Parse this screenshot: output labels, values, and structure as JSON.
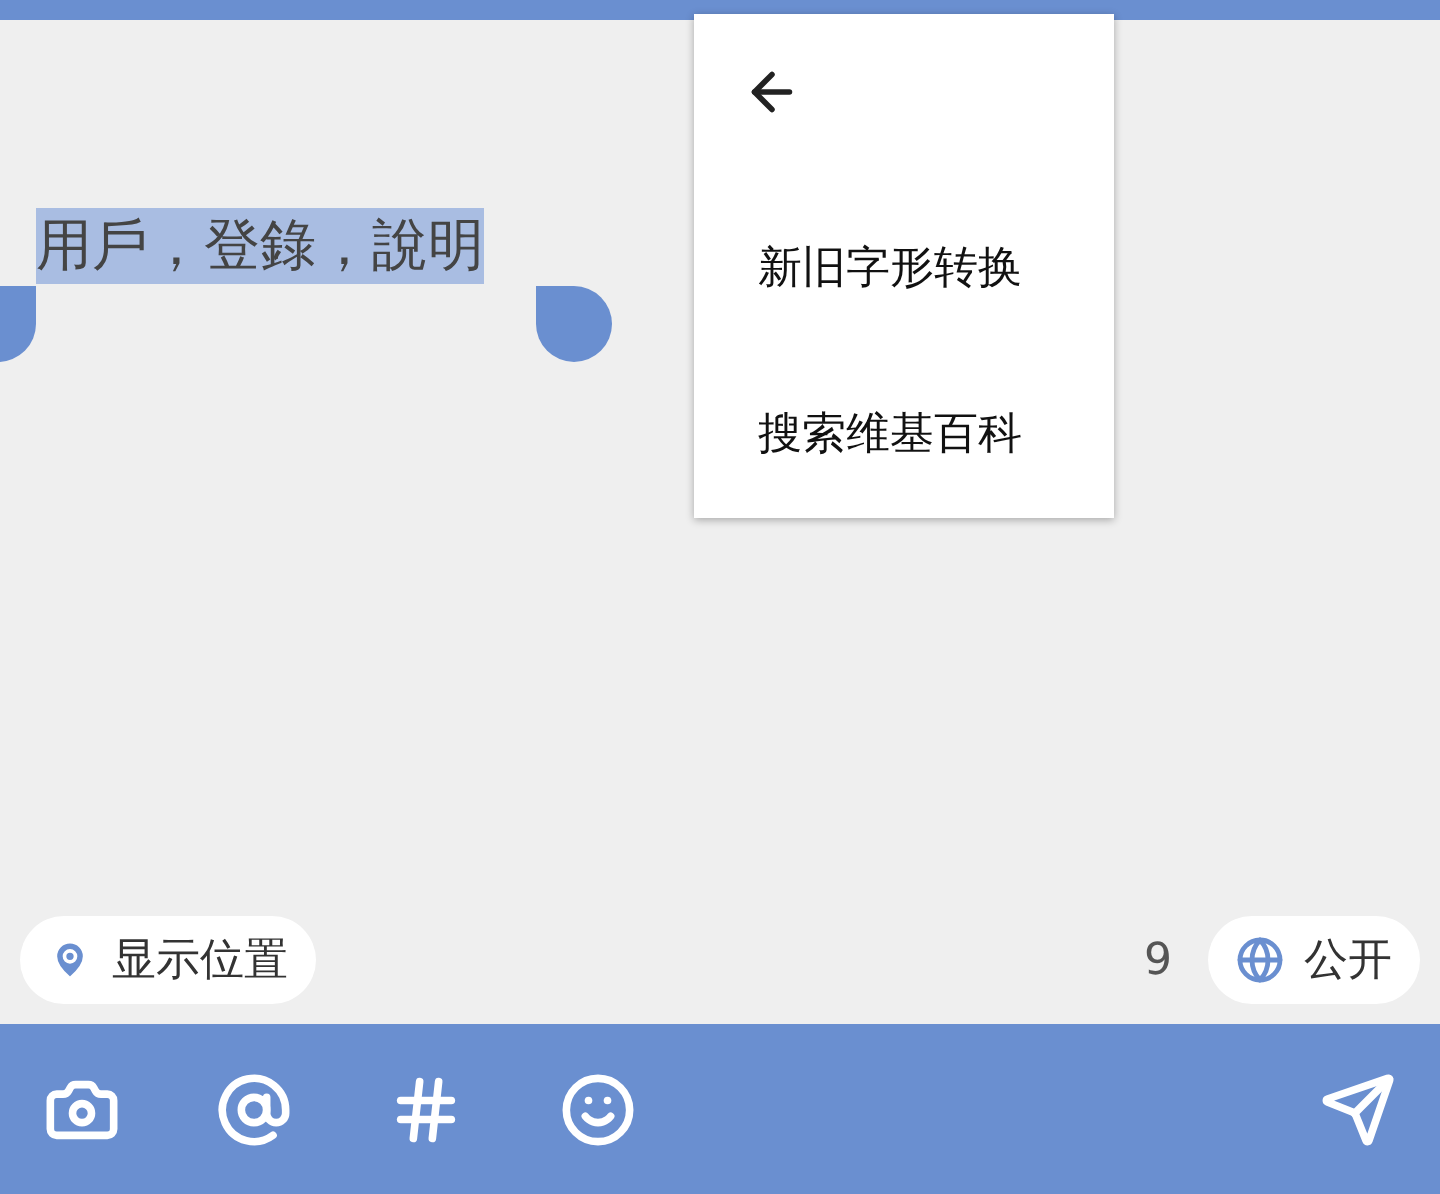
{
  "selected_text": "用戶，登錄，說明",
  "menu": {
    "items": [
      "新旧字形转换",
      "搜索维基百科"
    ]
  },
  "location_chip": {
    "label": "显示位置"
  },
  "char_count": "9",
  "visibility_chip": {
    "label": "公开"
  }
}
